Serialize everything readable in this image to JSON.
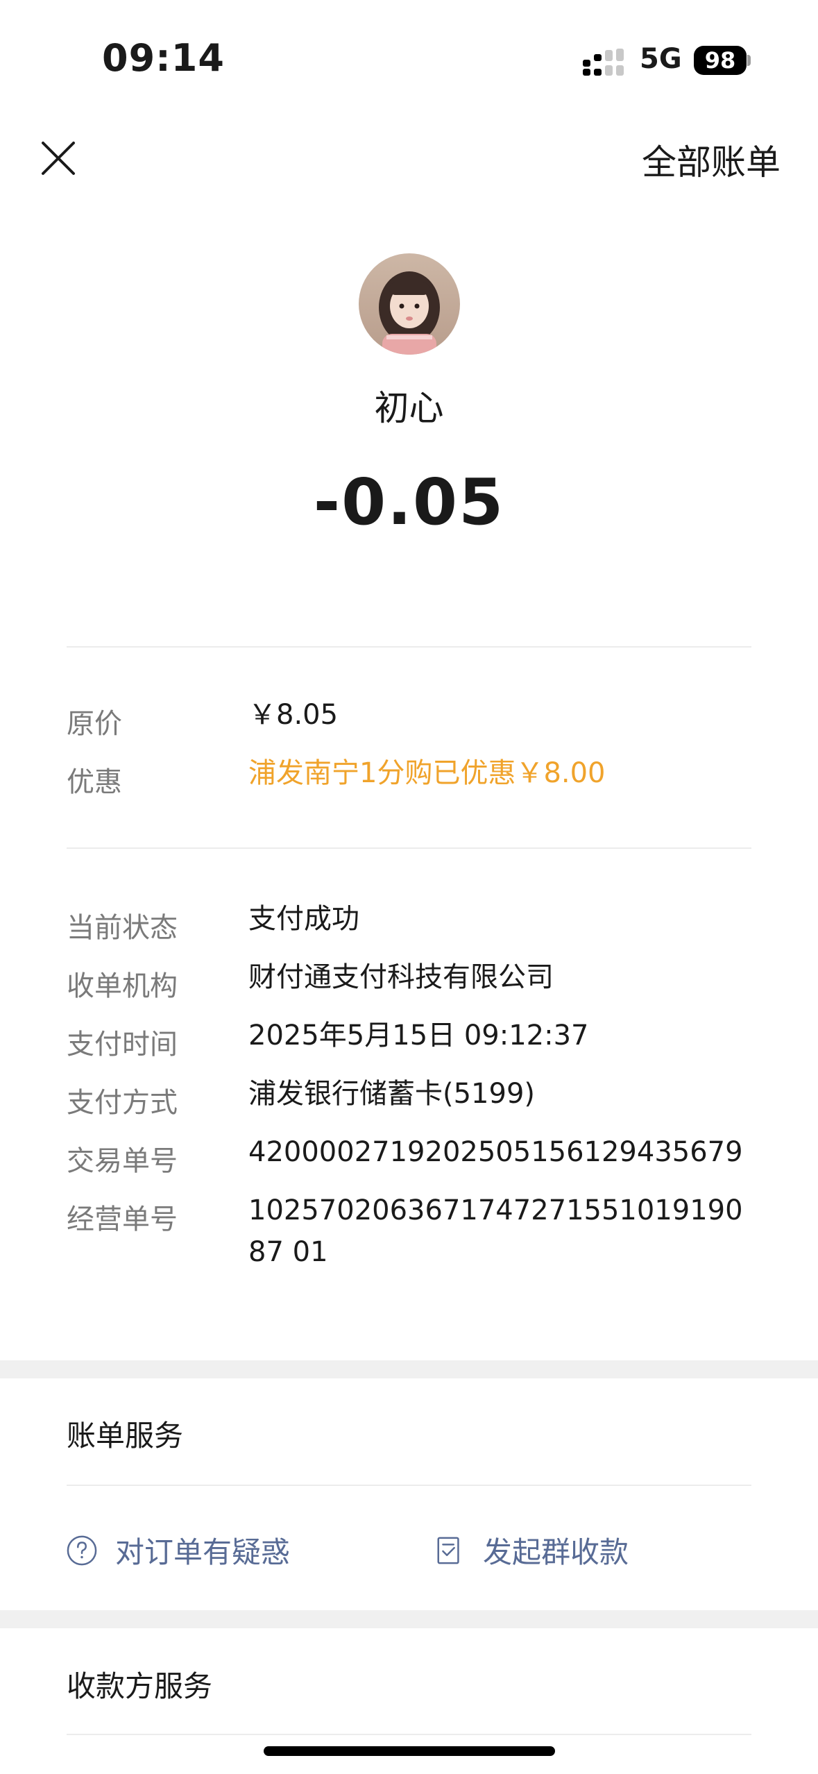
{
  "status_bar": {
    "time": "09:14",
    "network": "5G",
    "battery": "98"
  },
  "nav": {
    "close_icon": "close-icon",
    "all_bills": "全部账单"
  },
  "header": {
    "payee": "初心",
    "amount": "-0.05"
  },
  "pricing": [
    {
      "label": "原价",
      "value": "￥8.05"
    },
    {
      "label": "优惠",
      "value": "浦发南宁1分购已优惠￥8.00"
    }
  ],
  "details": [
    {
      "label": "当前状态",
      "value": "支付成功"
    },
    {
      "label": "收单机构",
      "value": "财付通支付科技有限公司"
    },
    {
      "label": "支付时间",
      "value": "2025年5月15日 09:12:37"
    },
    {
      "label": "支付方式",
      "value": "浦发银行储蓄卡(5199)"
    },
    {
      "label": "交易单号",
      "value": "4200002719202505156129435679"
    },
    {
      "label": "经营单号",
      "value": "102570206367174727155101919087 01"
    }
  ],
  "bill_service": {
    "title": "账单服务",
    "actions": [
      {
        "label": "对订单有疑惑",
        "icon": "question-circle-icon"
      },
      {
        "label": "发起群收款",
        "icon": "receipt-icon"
      }
    ]
  },
  "payee_service": {
    "title": "收款方服务"
  },
  "colors": {
    "accent_orange": "#f0a32b",
    "link_blue": "#586b95"
  }
}
